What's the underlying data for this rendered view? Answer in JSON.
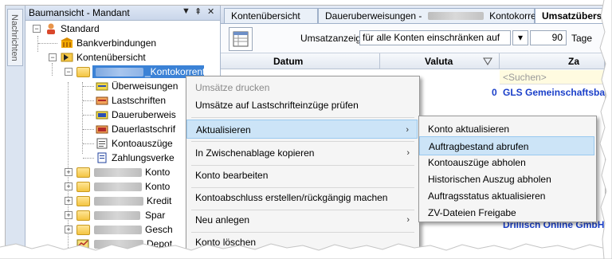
{
  "left_strip": {
    "tab_label": "Nachrichten"
  },
  "tree": {
    "title": "Baumansicht - Mandant",
    "header_icons": [
      "pin-dropdown-icon",
      "pin-icon",
      "close-icon"
    ],
    "header_glyphs": {
      "dropdown": "▼",
      "pin": "⇞",
      "close": "✕"
    },
    "items": [
      {
        "label": "Standard",
        "icon": "user-icon"
      },
      {
        "label": "Bankverbindungen",
        "icon": "bank-icon"
      },
      {
        "label": "Kontenübersicht",
        "icon": "arrow-icon"
      },
      {
        "label": "_Kontokorrent",
        "icon": "folder-icon"
      },
      {
        "label": "Überweisungen",
        "icon": "transfer-icon"
      },
      {
        "label": "Lastschriften",
        "icon": "debit-icon"
      },
      {
        "label": "Daueruberweis",
        "icon": "standing-order-icon"
      },
      {
        "label": "Dauerlastschrif",
        "icon": "standing-debit-icon"
      },
      {
        "label": "Kontoauszüge",
        "icon": "statement-icon"
      },
      {
        "label": "Zahlungsverke",
        "icon": "payment-icon"
      },
      {
        "label": "Konto",
        "icon": "folder-icon"
      },
      {
        "label": "Konto",
        "icon": "folder-icon"
      },
      {
        "label": "Kredit",
        "icon": "folder-icon"
      },
      {
        "label": "Spar",
        "icon": "folder-icon"
      },
      {
        "label": "Gesch",
        "icon": "folder-icon"
      },
      {
        "label": "Depot",
        "icon": "depot-icon"
      }
    ],
    "expander_minus": "−",
    "expander_plus": "+"
  },
  "tabs": [
    {
      "label": "Kontenübersicht"
    },
    {
      "label": "Daueruberweisungen -"
    },
    {
      "label": "Kontokorrent"
    },
    {
      "label": "Umsatzübersi"
    }
  ],
  "toolbar": {
    "filter_label": "Umsatzanzeige",
    "filter_value": "für alle Konten einschränken auf",
    "dropdown_arrow": "▾",
    "days_value": "90",
    "days_unit": "Tage"
  },
  "grid": {
    "columns": [
      "Datum",
      "Valuta",
      "Za"
    ],
    "search_placeholder": "<Suchen>",
    "rows": [
      {
        "c1": "0",
        "c2": "GLS Gemeinschaftsbar"
      },
      {
        "c1": "",
        "c2": "Drillisch Online GmbH"
      }
    ]
  },
  "context_menu": {
    "items": [
      {
        "label": "Umsätze drucken",
        "disabled": true
      },
      {
        "label": "Umsätze auf Lastschrifteinzüge prüfen"
      },
      {
        "label": "Aktualisieren",
        "submenu": true,
        "hover": true
      },
      {
        "label": "In Zwischenablage kopieren",
        "submenu": true
      },
      {
        "label": "Konto bearbeiten"
      },
      {
        "label": "Kontoabschluss erstellen/rückgängig machen"
      },
      {
        "label": "Neu anlegen",
        "submenu": true
      },
      {
        "label": "Konto löschen"
      }
    ],
    "submenu_arrow": "›"
  },
  "submenu": {
    "items": [
      {
        "label": "Konto aktualisieren"
      },
      {
        "label": "Auftragbestand abrufen",
        "hover": true
      },
      {
        "label": "Kontoauszüge abholen"
      },
      {
        "label": "Historischen Auszug abholen"
      },
      {
        "label": "Auftragsstatus aktualisieren"
      },
      {
        "label": "ZV-Dateien Freigabe"
      }
    ]
  },
  "colors": {
    "selection": "#3b82d6",
    "menu_hover": "#cce4f7",
    "link_blue": "#1a3fc9"
  }
}
